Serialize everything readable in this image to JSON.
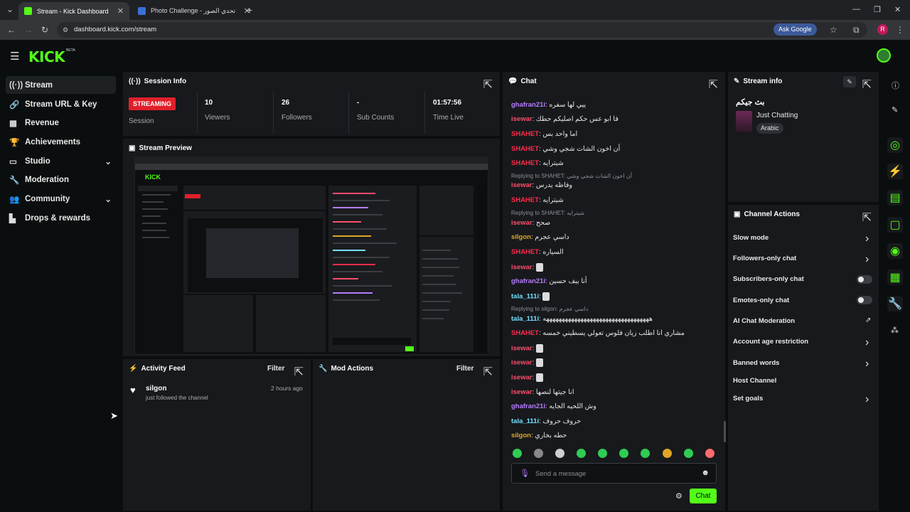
{
  "browser": {
    "tabs": [
      {
        "title": "Stream - Kick Dashboard",
        "active": true
      },
      {
        "title": "Photo Challenge - تحدي الصور",
        "active": false
      }
    ],
    "url": "dashboard.kick.com/stream",
    "ask_google": "Ask Google",
    "profile_initial": "R"
  },
  "app": {
    "logo": "KICK",
    "logo_badge": "BETA"
  },
  "sidebar": {
    "items": [
      {
        "label": "Stream",
        "icon": "stream-icon"
      },
      {
        "label": "Stream URL & Key",
        "icon": "link-icon"
      },
      {
        "label": "Revenue",
        "icon": "revenue-icon"
      },
      {
        "label": "Achievements",
        "icon": "trophy-icon"
      },
      {
        "label": "Studio",
        "icon": "studio-icon"
      },
      {
        "label": "Moderation",
        "icon": "wrench-icon"
      },
      {
        "label": "Community",
        "icon": "community-icon"
      },
      {
        "label": "Drops & rewards",
        "icon": "drops-icon"
      }
    ]
  },
  "session": {
    "title": "Session Info",
    "status_badge": "STREAMING",
    "status_label": "Session",
    "viewers_value": "10",
    "viewers_label": "Viewers",
    "followers_value": "26",
    "followers_label": "Followers",
    "subs_value": "-",
    "subs_label": "Sub Counts",
    "time_value": "01:57:56",
    "time_label": "Time Live"
  },
  "preview": {
    "title": "Stream Preview"
  },
  "activity": {
    "title": "Activity Feed",
    "filter": "Filter",
    "item_user": "silgon",
    "item_text": "just followed the channel",
    "item_time": "2 hours ago"
  },
  "mod": {
    "title": "Mod Actions",
    "filter": "Filter"
  },
  "chat": {
    "title": "Chat",
    "messages": [
      {
        "user": "ghafran21i",
        "text": "ييي لها سفره",
        "color": "#b67cff"
      },
      {
        "user": "isewar",
        "text": "فا ابو عس حكم اصليكم حطك",
        "color": "#ff4d6d"
      },
      {
        "user": "SHAHET",
        "text": "اما واحد بس",
        "color": "#ff2b4a"
      },
      {
        "user": "SHAHET",
        "text": "أن اخون الشات شجي وشي",
        "color": "#ff2b4a"
      },
      {
        "user": "SHAHET",
        "text": "شيترايه",
        "color": "#ff2b4a"
      },
      {
        "user": "isewar",
        "text": "وفاظه يدرس",
        "color": "#ff4d6d"
      },
      {
        "user": "SHAHET",
        "text": "شيترايه",
        "color": "#ff2b4a"
      },
      {
        "user": "isewar",
        "text": "صحح",
        "color": "#ff4d6d"
      },
      {
        "user": "silgon",
        "text": "داسي عجرم",
        "color": "#e0a526"
      },
      {
        "user": "SHAHET",
        "text": "السياره",
        "color": "#ff2b4a"
      },
      {
        "user": "isewar",
        "text": "",
        "color": "#ff4d6d"
      },
      {
        "user": "ghafran21i",
        "text": "أنا بيف حسين",
        "color": "#b67cff"
      },
      {
        "user": "tala_111i",
        "text": "",
        "color": "#74e0ff"
      },
      {
        "user": "tala_111i",
        "text": "ههههههههههههههههههههههههههههههههههه",
        "color": "#74e0ff"
      },
      {
        "user": "SHAHET",
        "text": "مشاري انا اطلب زيان فلوس تعولي يسطيني خمسه",
        "color": "#ff2b4a"
      },
      {
        "user": "isewar",
        "text": "",
        "color": "#ff4d6d"
      },
      {
        "user": "isewar",
        "text": "",
        "color": "#ff4d6d"
      },
      {
        "user": "isewar",
        "text": "",
        "color": "#ff4d6d"
      },
      {
        "user": "isewar",
        "text": "انا جيتها لنصها",
        "color": "#ff4d6d"
      },
      {
        "user": "ghafran21i",
        "text": "وش اللحيه الجايه",
        "color": "#b67cff"
      },
      {
        "user": "tala_111i",
        "text": "حروف حروف",
        "color": "#74e0ff"
      },
      {
        "user": "silgon",
        "text": "حطه بخاري",
        "color": "#e0a526"
      }
    ],
    "replies": [
      "Replying to SHAHET: أن اخون الشات شجي وشي",
      "Replying to SHAHET: شيترايه",
      "Replying to silgon: داسي عجرم"
    ],
    "input_placeholder": "Send a message",
    "send_label": "Chat"
  },
  "stream_info": {
    "title": "Stream info",
    "stream_title": "بث جيكم",
    "category": "Just Chatting",
    "language": "Arabic"
  },
  "channel_actions": {
    "title": "Channel Actions",
    "items": [
      {
        "label": "Slow mode",
        "control": "chevron"
      },
      {
        "label": "Followers-only chat",
        "control": "chevron"
      },
      {
        "label": "Subscribers-only chat",
        "control": "toggle"
      },
      {
        "label": "Emotes-only chat",
        "control": "toggle"
      },
      {
        "label": "AI Chat Moderation",
        "control": "external"
      },
      {
        "label": "Account age restriction",
        "control": "chevron"
      },
      {
        "label": "Banned words",
        "control": "chevron"
      },
      {
        "label": "Host Channel",
        "control": "none"
      },
      {
        "label": "Set goals",
        "control": "chevron"
      }
    ]
  },
  "colors": {
    "accent": "#53fc18",
    "streaming_badge": "#e01f2a",
    "panel_bg": "#17191c",
    "page_bg": "#0b0e0f"
  }
}
